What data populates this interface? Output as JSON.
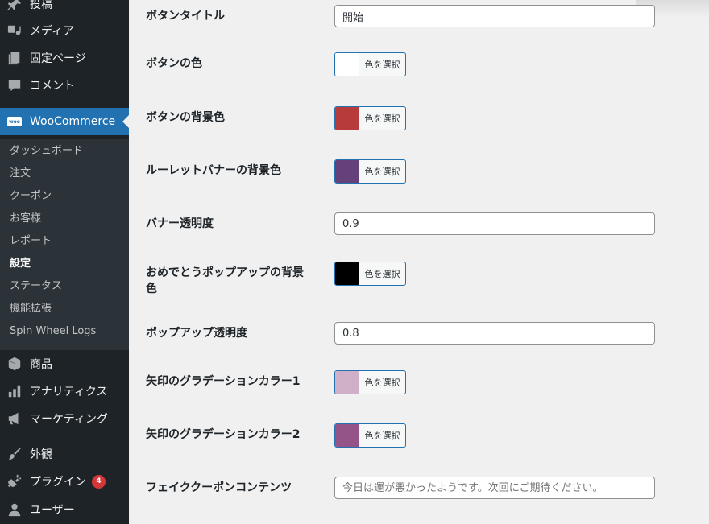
{
  "sidebar": {
    "menu": [
      {
        "label": "投稿",
        "icon": "pin-icon"
      },
      {
        "label": "メディア",
        "icon": "media-icon"
      },
      {
        "label": "固定ページ",
        "icon": "page-icon"
      },
      {
        "label": "コメント",
        "icon": "comment-icon"
      },
      {
        "label": "WooCommerce",
        "icon": "woocommerce-icon",
        "icon_text": "woo"
      },
      {
        "label": "商品",
        "icon": "product-box-icon"
      },
      {
        "label": "アナリティクス",
        "icon": "bar-chart-icon"
      },
      {
        "label": "マーケティング",
        "icon": "megaphone-icon"
      },
      {
        "label": "外観",
        "icon": "paintbrush-icon"
      },
      {
        "label": "プラグイン",
        "icon": "plugin-icon",
        "badge": "4"
      },
      {
        "label": "ユーザー",
        "icon": "user-icon"
      }
    ],
    "submenu": [
      {
        "label": "ダッシュボード"
      },
      {
        "label": "注文"
      },
      {
        "label": "クーポン"
      },
      {
        "label": "お客様"
      },
      {
        "label": "レポート"
      },
      {
        "label": "設定"
      },
      {
        "label": "ステータス"
      },
      {
        "label": "機能拡張"
      },
      {
        "label": "Spin Wheel Logs"
      }
    ]
  },
  "settings": {
    "color_button_label": "色を選択",
    "rows": [
      {
        "label": "ボタンタイトル",
        "type": "text",
        "value": "開始"
      },
      {
        "label": "ボタンの色",
        "type": "color",
        "color": "#ffffff"
      },
      {
        "label": "ボタンの背景色",
        "type": "color",
        "color": "#b83b3b"
      },
      {
        "label": "ルーレットバナーの背景色",
        "type": "color",
        "color": "#65417a"
      },
      {
        "label": "バナー透明度",
        "type": "text",
        "value": "0.9"
      },
      {
        "label": "おめでとうポップアップの背景色",
        "type": "color",
        "color": "#000000"
      },
      {
        "label": "ポップアップ透明度",
        "type": "text",
        "value": "0.8"
      },
      {
        "label": "矢印のグラデーションカラー1",
        "type": "color",
        "color": "#cfb0c8"
      },
      {
        "label": "矢印のグラデーションカラー2",
        "type": "color",
        "color": "#955488"
      },
      {
        "label": "フェイククーポンコンテンツ",
        "type": "text",
        "placeholder": "今日は運が悪かったようです。次回にご期待ください。"
      }
    ]
  },
  "colors": {
    "sidebar_bg": "#1d2327",
    "submenu_bg": "#2c3338",
    "active_bg": "#2271b1",
    "badge_bg": "#d63638",
    "content_bg": "#f0f0f1"
  }
}
